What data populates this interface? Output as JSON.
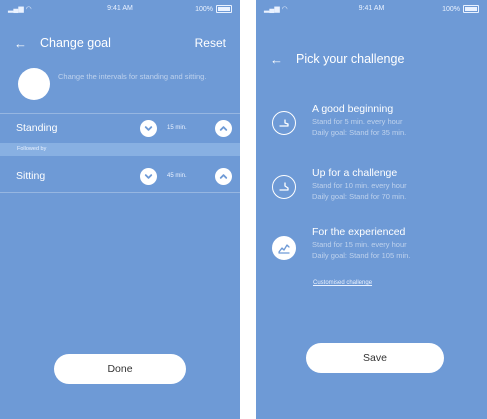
{
  "left_screen": {
    "status": {
      "time": "9:41 AM",
      "battery": "100%"
    },
    "header": {
      "title": "Change goal",
      "reset_label": "Reset"
    },
    "info_text": "Change the intervals for standing and sitting.",
    "standing": {
      "label": "Standing",
      "value": "15 min."
    },
    "followed_by_label": "Followed by",
    "sitting": {
      "label": "Sitting",
      "value": "45 min."
    },
    "done_label": "Done"
  },
  "right_screen": {
    "status": {
      "time": "9:41 AM",
      "battery": "100%"
    },
    "header": {
      "title": "Pick your challenge"
    },
    "challenges": [
      {
        "title": "A good beginning",
        "line1": "Stand for 5 min. every hour",
        "line2": "Daily goal: Stand for 35 min.",
        "icon": "stand-icon"
      },
      {
        "title": "Up for a challenge",
        "line1": "Stand for 10 min. every hour",
        "line2": "Daily goal: Stand for 70 min.",
        "icon": "stand-icon"
      },
      {
        "title": "For the experienced",
        "line1": "Stand for 15 min. every hour",
        "line2": "Daily goal: Stand for 105 min.",
        "icon": "trend-icon",
        "selected": true
      }
    ],
    "custom_link": "Customised challenge",
    "save_label": "Save"
  },
  "colors": {
    "background": "#6e9ad6",
    "band": "#88b0e2",
    "button": "#ffffff",
    "button_text": "#333333"
  }
}
